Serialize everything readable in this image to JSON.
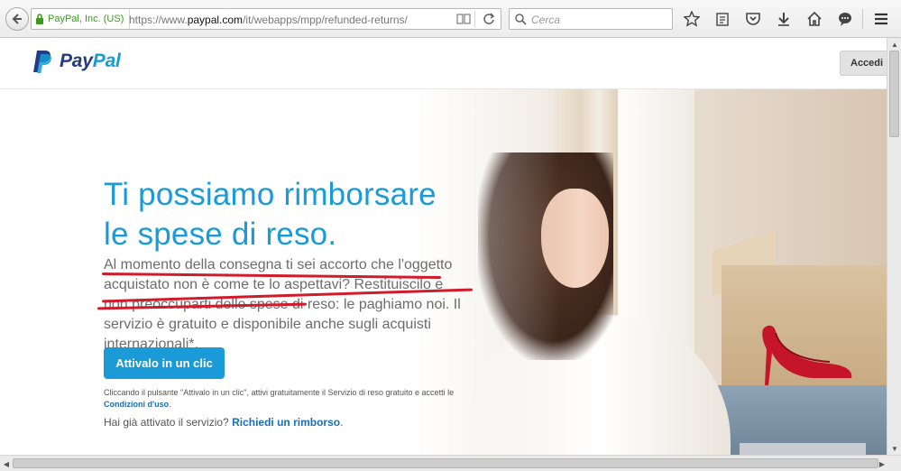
{
  "browser": {
    "identity_label": "PayPal, Inc. (US)",
    "url_prefix": "https://www.",
    "url_domain": "paypal.com",
    "url_path": "/it/webapps/mpp/refunded-returns/",
    "search_placeholder": "Cerca"
  },
  "header": {
    "logo_text_1": "Pay",
    "logo_text_2": "Pal",
    "login_label": "Accedi"
  },
  "hero": {
    "headline_line1": "Ti possiamo rimborsare",
    "headline_line2": "le spese di reso.",
    "body": "Al momento della consegna ti sei accorto che l'oggetto acquistato non è come te lo aspettavi? Restituiscilo e non preoccuparti delle spese di reso: le paghiamo noi. Il servizio è gratuito e disponibile anche sugli acquisti internazionali*.",
    "cta_label": "Attivalo in un clic",
    "legal_text": "Cliccando il pulsante \"Attivalo in un clic\", attivi gratuitamente il Servizio di reso gratuito e accetti le",
    "legal_link": "Condizioni d'uso",
    "legal_end": ".",
    "already_text": "Hai già attivato il servizio?",
    "already_link": "Richiedi un rimborso",
    "already_end": "."
  },
  "colors": {
    "paypal_blue": "#1a9bd8",
    "paypal_navy": "#253b80",
    "annotation_red": "#d11a2a"
  }
}
